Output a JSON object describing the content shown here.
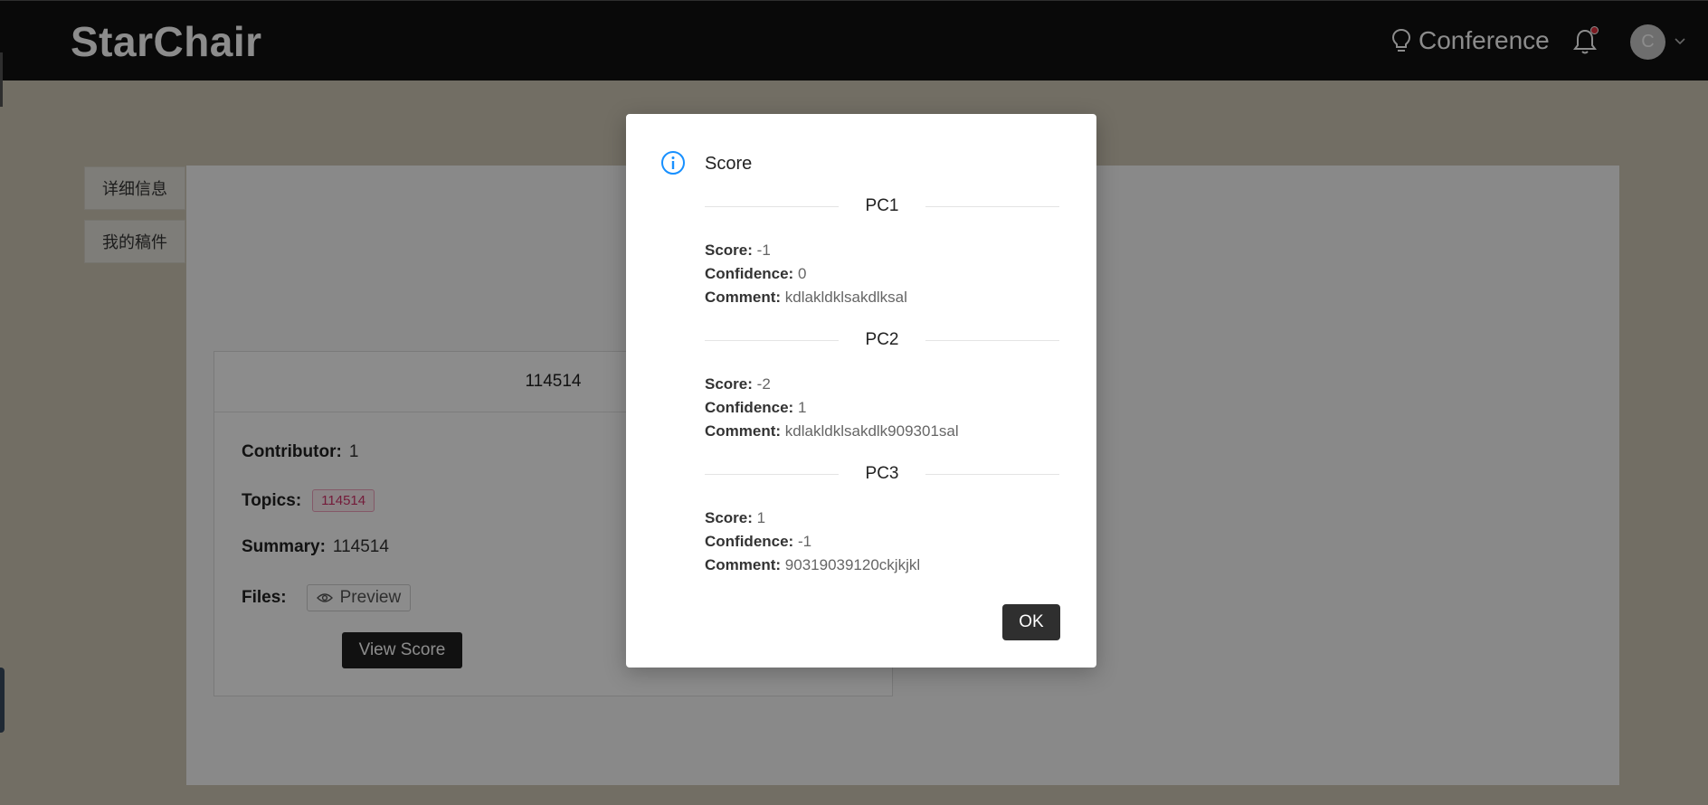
{
  "header": {
    "logo": "StarChair",
    "conference_label": "Conference",
    "avatar_initial": "C"
  },
  "sidebar": {
    "tabs": [
      {
        "label": "详细信息"
      },
      {
        "label": "我的稿件"
      }
    ]
  },
  "card": {
    "title": "114514",
    "contributor_label": "Contributor:",
    "contributor_value": "1",
    "topics_label": "Topics:",
    "topic_tag": "114514",
    "summary_label": "Summary:",
    "summary_value": "114514",
    "files_label": "Files:",
    "preview_label": "Preview",
    "view_score_label": "View Score"
  },
  "modal": {
    "title": "Score",
    "score_label": "Score:",
    "confidence_label": "Confidence:",
    "comment_label": "Comment:",
    "reviews": [
      {
        "name": "PC1",
        "score": "-1",
        "confidence": "0",
        "comment": "kdlakldklsakdlksal"
      },
      {
        "name": "PC2",
        "score": "-2",
        "confidence": "1",
        "comment": "kdlakldklsakdlk909301sal"
      },
      {
        "name": "PC3",
        "score": "1",
        "confidence": "-1",
        "comment": "90319039120ckjkjkl"
      }
    ],
    "ok_label": "OK"
  },
  "colors": {
    "header_bg": "#111111",
    "primary_button": "#1f1f1f",
    "info_icon": "#1890ff",
    "tag_text": "#d4336b",
    "notification_dot": "#e0303c"
  }
}
